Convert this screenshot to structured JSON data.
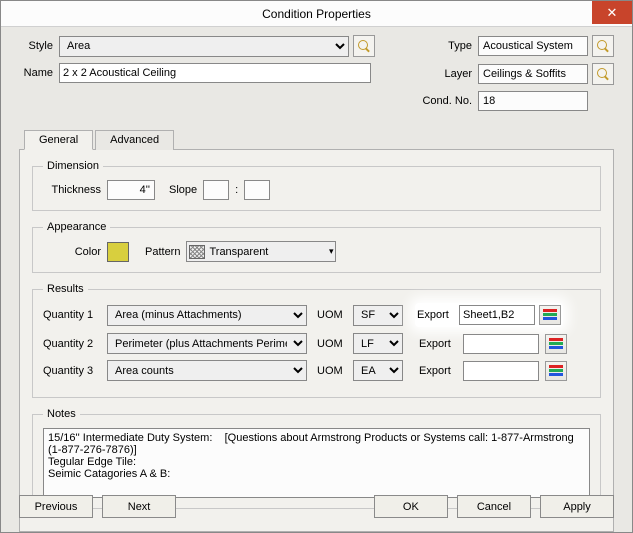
{
  "window": {
    "title": "Condition Properties"
  },
  "labels": {
    "style": "Style",
    "name": "Name",
    "type": "Type",
    "layer": "Layer",
    "cond_no": "Cond. No.",
    "thickness": "Thickness",
    "slope": "Slope",
    "color": "Color",
    "pattern": "Pattern",
    "quantity1": "Quantity 1",
    "quantity2": "Quantity 2",
    "quantity3": "Quantity 3",
    "uom": "UOM",
    "export": "Export"
  },
  "fields": {
    "style": "Area",
    "name": "2 x 2 Acoustical Ceiling",
    "type": "Acoustical System",
    "layer": "Ceilings & Soffits",
    "cond_no": "18",
    "thickness": "4''",
    "slope1": "",
    "slope2": "",
    "pattern": "Transparent"
  },
  "tabs": {
    "general": "General",
    "advanced": "Advanced"
  },
  "groups": {
    "dimension": "Dimension",
    "appearance": "Appearance",
    "results": "Results",
    "notes": "Notes"
  },
  "results": {
    "q1": {
      "sel": "Area (minus Attachments)",
      "uom": "SF",
      "export": "Sheet1,B2"
    },
    "q2": {
      "sel": "Perimeter (plus Attachments Perimeter)",
      "uom": "LF",
      "export": ""
    },
    "q3": {
      "sel": "Area counts",
      "uom": "EA",
      "export": ""
    }
  },
  "notes": "15/16'' Intermediate Duty System:    [Questions about Armstrong Products or Systems call: 1-877-Armstrong\n(1-877-276-7876)]\nTegular Edge Tile:\nSeimic Catagories A & B:",
  "buttons": {
    "previous": "Previous",
    "next": "Next",
    "ok": "OK",
    "cancel": "Cancel",
    "apply": "Apply"
  }
}
